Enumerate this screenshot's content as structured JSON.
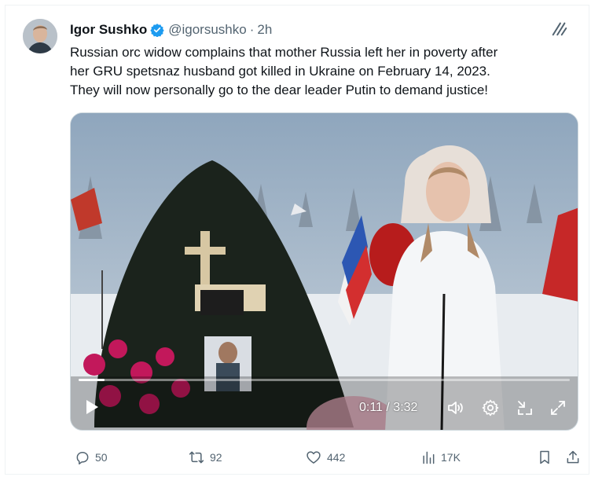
{
  "tweet": {
    "author_name": "Igor Sushko",
    "handle": "@igorsushko",
    "separator": "·",
    "time": "2h",
    "text_lines": [
      "Russian orc widow complains that mother Russia left her in poverty after",
      "her GRU spetsnaz husband got killed in Ukraine on February 14, 2023.",
      "They will now personally go to the dear leader Putin to demand justice!"
    ]
  },
  "video": {
    "timecode": "0:11 / 3:32",
    "progress": 0.052
  },
  "actions": {
    "replies": "50",
    "reposts": "92",
    "likes": "442",
    "views": "17K"
  },
  "colors": {
    "text": "#0f1419",
    "secondary": "#536471",
    "verified_blue": "#1d9bf0"
  },
  "icons": {
    "verified": "verified-badge-icon",
    "grok": "grok-icon",
    "play": "play-icon",
    "volume": "volume-icon",
    "settings": "gear-icon",
    "minimize": "minimize-icon",
    "fullscreen": "fullscreen-icon",
    "reply": "reply-icon",
    "repost": "repost-icon",
    "like": "heart-icon",
    "views": "views-icon",
    "bookmark": "bookmark-icon",
    "share": "share-icon"
  }
}
